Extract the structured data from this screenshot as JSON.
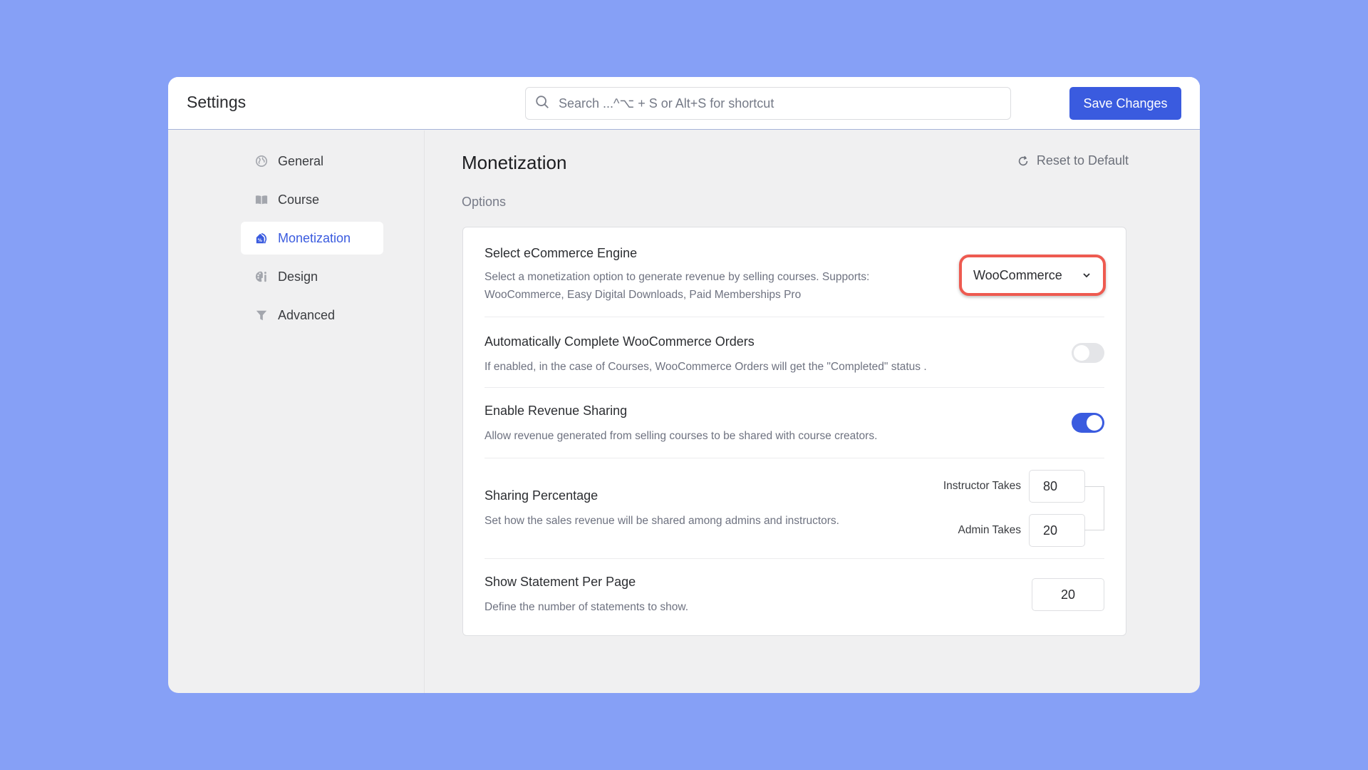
{
  "header": {
    "title": "Settings",
    "search_placeholder": "Search ...^⌥ + S or Alt+S for shortcut",
    "save_label": "Save Changes"
  },
  "sidebar": {
    "items": [
      {
        "label": "General",
        "icon": "globe-icon",
        "active": false
      },
      {
        "label": "Course",
        "icon": "book-icon",
        "active": false
      },
      {
        "label": "Monetization",
        "icon": "price-tag-icon",
        "active": true
      },
      {
        "label": "Design",
        "icon": "palette-icon",
        "active": false
      },
      {
        "label": "Advanced",
        "icon": "filter-icon",
        "active": false
      }
    ]
  },
  "main": {
    "title": "Monetization",
    "reset_label": "Reset to Default",
    "section_label": "Options",
    "settings": {
      "ecommerce": {
        "title": "Select eCommerce Engine",
        "description": "Select a monetization option to generate revenue by selling courses. Supports: WooCommerce, Easy Digital Downloads, Paid Memberships Pro",
        "desc_line1": "Select a monetization option to generate revenue by selling courses. Supports:",
        "desc_line2": "WooCommerce, Easy Digital Downloads, Paid Memberships Pro",
        "selected": "WooCommerce"
      },
      "auto_complete": {
        "title": "Automatically Complete WooCommerce Orders",
        "description": "If enabled, in the case of Courses, WooCommerce Orders will get the \"Completed\" status .",
        "enabled": false
      },
      "revenue_sharing": {
        "title": "Enable Revenue Sharing",
        "description": "Allow revenue generated from selling courses to be shared with course creators.",
        "enabled": true
      },
      "sharing_percentage": {
        "title": "Sharing Percentage",
        "description": "Set how the sales revenue will be shared among admins and instructors.",
        "instructor_label": "Instructor Takes",
        "instructor_value": "80",
        "admin_label": "Admin Takes",
        "admin_value": "20"
      },
      "statement_per_page": {
        "title": "Show Statement Per Page",
        "description": "Define the number of statements to show.",
        "value": "20"
      }
    }
  },
  "colors": {
    "background": "#86a0f6",
    "accent": "#3a5bdf",
    "highlight_ring": "#ee5a50"
  }
}
